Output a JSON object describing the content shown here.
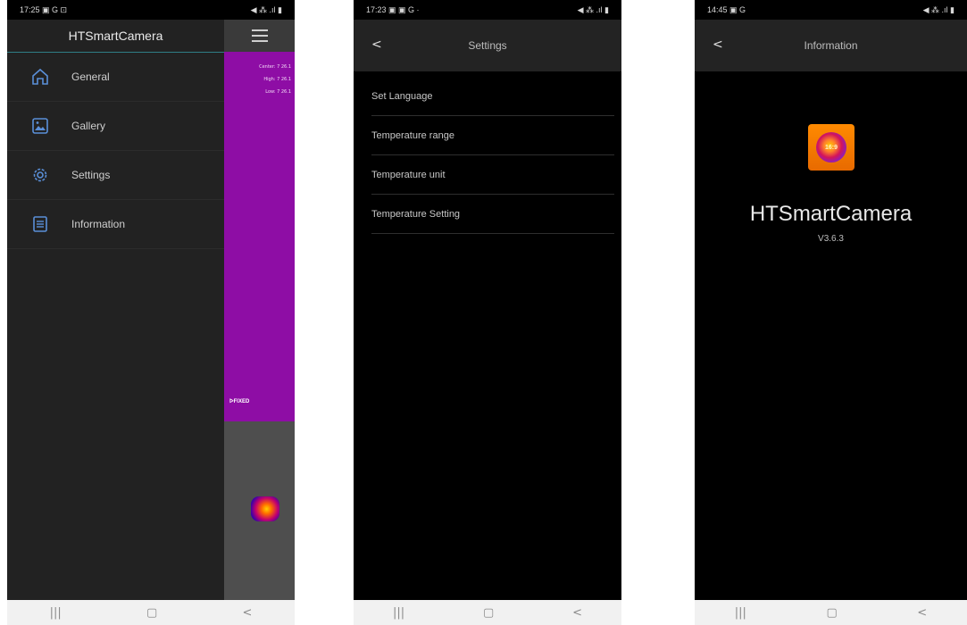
{
  "phone1": {
    "status": {
      "time": "17:25",
      "notif_icons": "▣ G ⊡",
      "right_icons": "◀ ⁂ .ıl ▮"
    },
    "drawer": {
      "title": "HTSmartCamera",
      "items": [
        {
          "label": "General",
          "icon": "home-icon"
        },
        {
          "label": "Gallery",
          "icon": "gallery-icon"
        },
        {
          "label": "Settings",
          "icon": "gear-icon"
        },
        {
          "label": "Information",
          "icon": "info-icon"
        }
      ]
    },
    "background": {
      "readouts": [
        "Center: 7 26.1",
        "High: 7 26.1",
        "Low: 7 26.1"
      ],
      "unit_label": "ᐅFIXED"
    },
    "nav": {
      "recents": "|||",
      "home": "▢",
      "back": "<"
    }
  },
  "phone2": {
    "status": {
      "time": "17:23",
      "notif_icons": "▣ ▣ G ·",
      "right_icons": "◀ ⁂ .ıl ▮"
    },
    "title": "Settings",
    "back": "<",
    "rows": [
      "Set Language",
      "Temperature range",
      "Temperature unit",
      "Temperature Setting"
    ],
    "nav": {
      "recents": "|||",
      "home": "▢",
      "back": "<"
    }
  },
  "phone3": {
    "status": {
      "time": "14:45",
      "notif_icons": "▣ G",
      "right_icons": "◀ ⁂ .ıl ▮"
    },
    "title": "Information",
    "back": "<",
    "logo_text": "16:9",
    "app_name": "HTSmartCamera",
    "version": "V3.6.3",
    "nav": {
      "recents": "|||",
      "home": "▢",
      "back": "<"
    }
  }
}
